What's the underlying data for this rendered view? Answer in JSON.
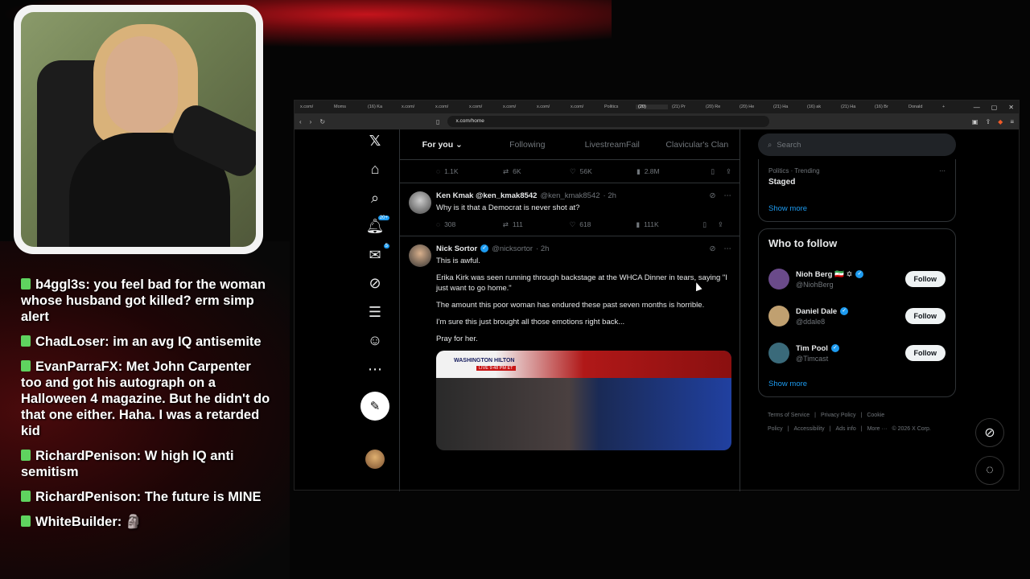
{
  "chat": [
    {
      "user": "b4ggl3s",
      "text": "b4ggl3s: you feel bad for the woman whose husband got killed? erm simp alert"
    },
    {
      "user": "ChadLoser",
      "text": "ChadLoser: im an avg IQ antisemite"
    },
    {
      "user": "EvanParraFX",
      "text": "EvanParraFX: Met John Carpenter too and got his autograph on a Halloween 4 magazine. But he didn't do that one either. Haha. I was a retarded kid"
    },
    {
      "user": "RichardPenison",
      "text": "RichardPenison: W high IQ anti semitism"
    },
    {
      "user": "RichardPenison",
      "text": "RichardPenison: The future is MINE"
    },
    {
      "user": "WhiteBuilder",
      "text": "WhiteBuilder:"
    }
  ],
  "browser": {
    "tabs": [
      "x.com/",
      "Moms",
      "(16) Ka",
      "x.com/",
      "x.com/",
      "x.com/",
      "x.com/",
      "x.com/",
      "x.com/",
      "Politics",
      "(20)",
      "(21) Pr",
      "(20) Re",
      "(20) He",
      "(21) Ha",
      "(16) ak",
      "(21) Ha",
      "(16) Br",
      "Donald"
    ],
    "url": "x.com/home"
  },
  "nav": {
    "notifications_badge": "20+",
    "messages_badge": "5"
  },
  "feed": {
    "tabs": [
      "For you",
      "Following",
      "LivestreamFail",
      "Clavicular's Clan"
    ],
    "top_actions": {
      "replies": "1.1K",
      "reposts": "6K",
      "likes": "56K",
      "views": "2.8M"
    },
    "tweets": [
      {
        "name": "Ken Kmak @ken_kmak8542",
        "handle": "@ken_kmak8542",
        "time": "· 2h",
        "text": "Why is it that a Democrat is never shot at?",
        "replies": "308",
        "reposts": "111",
        "likes": "618",
        "views": "111K"
      },
      {
        "name": "Nick Sortor",
        "handle": "@nicksortor",
        "time": "· 2h",
        "paragraphs": [
          "This is awful.",
          "Erika Kirk was seen running through backstage at the WHCA Dinner in tears, saying \"I just want to go home.\"",
          "The amount this poor woman has endured these past seven months is horrible.",
          "I'm sure this just brought all those emotions right back...",
          "Pray for her."
        ],
        "image_label": "WASHINGTON HILTON",
        "image_live": "LIVE  9:48 PM ET"
      }
    ]
  },
  "sidebar": {
    "search_placeholder": "Search",
    "trend_category": "Politics · Trending",
    "trend_name": "Staged",
    "show_more": "Show more",
    "who_to_follow_title": "Who to follow",
    "follow_label": "Follow",
    "suggestions": [
      {
        "name": "Nioh Berg 🇮🇷 ✡",
        "handle": "@NiohBerg",
        "color": "#6a4a8a"
      },
      {
        "name": "Daniel Dale",
        "handle": "@ddale8",
        "color": "#c0a070"
      },
      {
        "name": "Tim Pool",
        "handle": "@Timcast",
        "color": "#3a6a7a"
      }
    ],
    "show_more_2": "Show more",
    "footer": [
      "Terms of Service",
      "|",
      "Privacy Policy",
      "|",
      "Cookie Policy",
      "|",
      "Accessibility",
      "|",
      "Ads info",
      "|",
      "More ···",
      "© 2026 X Corp."
    ]
  },
  "colors": {
    "accent": "#1d9bf0",
    "background": "#000000",
    "chat_badge": "#5fd35f"
  }
}
